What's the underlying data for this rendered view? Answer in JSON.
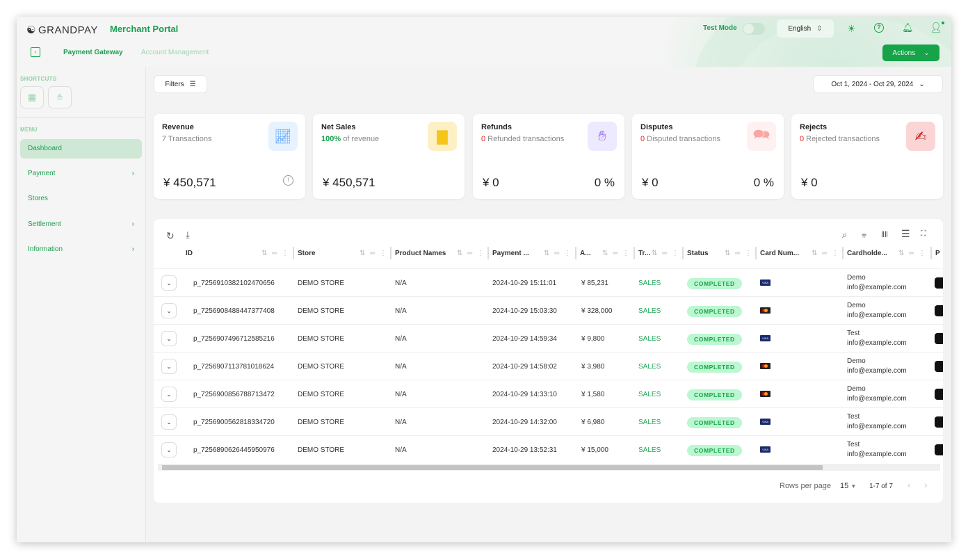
{
  "header": {
    "brand": "GRANDPAY",
    "portal": "Merchant Portal",
    "test_mode_label": "Test Mode",
    "test_mode_on": false,
    "language": "English",
    "actions_label": "Actions"
  },
  "nav": {
    "tabs": [
      {
        "label": "Payment Gateway",
        "active": true
      },
      {
        "label": "Account Management",
        "active": false
      }
    ]
  },
  "sidebar": {
    "shortcuts_label": "SHORTCUTS",
    "menu_label": "MENU",
    "items": [
      {
        "label": "Dashboard",
        "active": true,
        "chevron": false
      },
      {
        "label": "Payment",
        "chevron": true
      },
      {
        "label": "Stores",
        "chevron": false
      },
      {
        "label": "Settlement",
        "chevron": true
      },
      {
        "label": "Information",
        "chevron": true
      }
    ]
  },
  "toolbar": {
    "filters_label": "Filters",
    "date_range": "Oct 1, 2024 - Oct 29, 2024"
  },
  "cards": [
    {
      "title": "Revenue",
      "sub_prefix": "",
      "sub": "7 Transactions",
      "value": "¥ 450,571",
      "extra": "",
      "icon": "revenue-chart-icon",
      "accent": "#e6f2fe"
    },
    {
      "title": "Net Sales",
      "sub_prefix": "100%",
      "sub": " of revenue",
      "value": "¥ 450,571",
      "extra": "",
      "icon": "bar-chart-icon",
      "accent": "#fdf0c4"
    },
    {
      "title": "Refunds",
      "sub_prefix": "0",
      "sub": " Refunded transactions",
      "value": "¥ 0",
      "extra": "0 %",
      "icon": "refund-hand-icon",
      "accent": "#ede9fe"
    },
    {
      "title": "Disputes",
      "sub_prefix": "0",
      "sub": " Disputed transactions",
      "value": "¥ 0",
      "extra": "0 %",
      "icon": "dispute-chat-icon",
      "accent": "#fef1f1"
    },
    {
      "title": "Rejects",
      "sub_prefix": "0",
      "sub": " Rejected transactions",
      "value": "¥ 0",
      "extra": "",
      "icon": "reject-hand-icon",
      "accent": "#fbd5d5"
    }
  ],
  "table": {
    "columns": [
      "ID",
      "Store",
      "Product Names",
      "Payment ...",
      "A...",
      "Tr...",
      "Status",
      "Card Num...",
      "Cardholde...",
      "P"
    ],
    "rows": [
      {
        "id": "p_7256910382102470656",
        "store": "DEMO STORE",
        "product": "N/A",
        "date": "2024-10-29 15:11:01",
        "amount": "¥ 85,231",
        "type": "SALES",
        "status": "COMPLETED",
        "card": "visa",
        "name": "Demo",
        "email": "info@example.com"
      },
      {
        "id": "p_7256908488447377408",
        "store": "DEMO STORE",
        "product": "N/A",
        "date": "2024-10-29 15:03:30",
        "amount": "¥ 328,000",
        "type": "SALES",
        "status": "COMPLETED",
        "card": "mastercard",
        "name": "Demo",
        "email": "info@example.com"
      },
      {
        "id": "p_7256907496712585216",
        "store": "DEMO STORE",
        "product": "N/A",
        "date": "2024-10-29 14:59:34",
        "amount": "¥ 9,800",
        "type": "SALES",
        "status": "COMPLETED",
        "card": "visa",
        "name": "Test",
        "email": "info@example.com"
      },
      {
        "id": "p_7256907113781018624",
        "store": "DEMO STORE",
        "product": "N/A",
        "date": "2024-10-29 14:58:02",
        "amount": "¥ 3,980",
        "type": "SALES",
        "status": "COMPLETED",
        "card": "mastercard",
        "name": "Demo",
        "email": "info@example.com"
      },
      {
        "id": "p_7256900856788713472",
        "store": "DEMO STORE",
        "product": "N/A",
        "date": "2024-10-29 14:33:10",
        "amount": "¥ 1,580",
        "type": "SALES",
        "status": "COMPLETED",
        "card": "mastercard",
        "name": "Demo",
        "email": "info@example.com"
      },
      {
        "id": "p_7256900562818334720",
        "store": "DEMO STORE",
        "product": "N/A",
        "date": "2024-10-29 14:32:00",
        "amount": "¥ 6,980",
        "type": "SALES",
        "status": "COMPLETED",
        "card": "visa",
        "name": "Test",
        "email": "info@example.com"
      },
      {
        "id": "p_7256890626445950976",
        "store": "DEMO STORE",
        "product": "N/A",
        "date": "2024-10-29 13:52:31",
        "amount": "¥ 15,000",
        "type": "SALES",
        "status": "COMPLETED",
        "card": "visa",
        "name": "Test",
        "email": "info@example.com"
      }
    ]
  },
  "pagination": {
    "rows_per_page_label": "Rows per page",
    "rows_per_page": "15",
    "range": "1-7 of 7"
  }
}
